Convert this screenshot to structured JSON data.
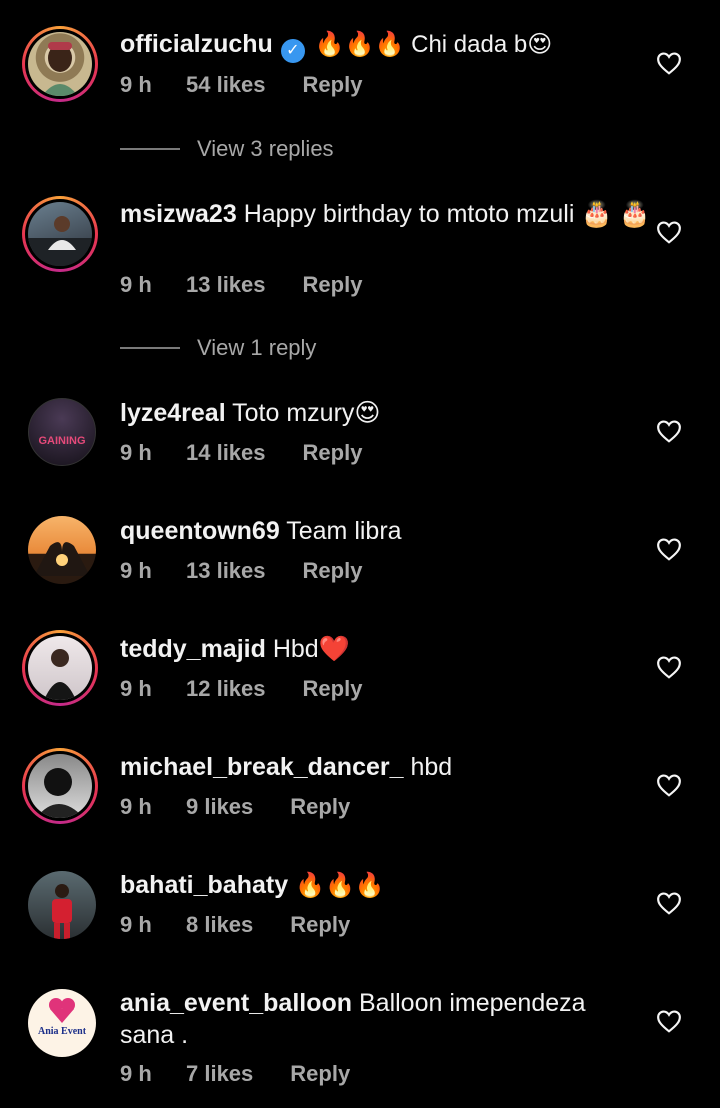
{
  "comments": [
    {
      "username": "officialzuchu",
      "verified": true,
      "text": "🔥🔥🔥 Chi dada b😍",
      "time": "9 h",
      "likes": "54 likes",
      "reply": "Reply",
      "view_replies": "View 3 replies"
    },
    {
      "username": "msizwa23",
      "verified": false,
      "text": "Happy birthday to mtoto mzuli 🎂 🎂",
      "time": "9 h",
      "likes": "13 likes",
      "reply": "Reply",
      "view_replies": "View 1 reply"
    },
    {
      "username": "lyze4real",
      "verified": false,
      "text": "Toto mzury😍",
      "time": "9 h",
      "likes": "14 likes",
      "reply": "Reply",
      "avatar_text": "GAINING"
    },
    {
      "username": "queentown69",
      "verified": false,
      "text": "Team libra",
      "time": "9 h",
      "likes": "13 likes",
      "reply": "Reply"
    },
    {
      "username": "teddy_majid",
      "verified": false,
      "text": "Hbd❤️",
      "time": "9 h",
      "likes": "12 likes",
      "reply": "Reply"
    },
    {
      "username": "michael_break_dancer_",
      "verified": false,
      "text": "hbd",
      "time": "9 h",
      "likes": "9 likes",
      "reply": "Reply"
    },
    {
      "username": "bahati_bahaty",
      "verified": false,
      "text": "🔥🔥🔥",
      "time": "9 h",
      "likes": "8 likes",
      "reply": "Reply"
    },
    {
      "username": "ania_event_balloon",
      "verified": false,
      "text": "Balloon imependeza sana .",
      "time": "9 h",
      "likes": "7 likes",
      "reply": "Reply",
      "avatar_text": "Ania Event"
    }
  ],
  "icons": {
    "like": "heart-outline-icon",
    "verified": "verified-badge-icon"
  },
  "colors": {
    "background": "#000000",
    "verified": "#3897f0",
    "meta": "#a8a8a8",
    "story_ring": "#e8364f"
  }
}
